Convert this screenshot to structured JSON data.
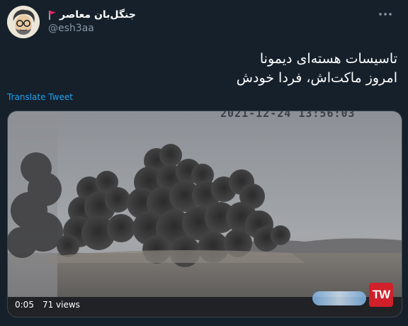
{
  "author": {
    "display_name": "جنگل‌بان معاصر",
    "handle": "@esh3aa",
    "flag_icon": "red-flag-icon"
  },
  "tweet": {
    "line1": "تاسیسات هسته‌ای دیمونا",
    "line2": "امروز ماکت‌اش، فردا خودش",
    "translate_label": "Translate Tweet"
  },
  "media": {
    "overlay_timestamp": "2021-12-24  13:56:03",
    "duration": "0:05",
    "views": "71 views",
    "channel_logo": "TW"
  },
  "colors": {
    "background": "#15202b",
    "link": "#1da1f2",
    "muted": "#8899a6"
  }
}
